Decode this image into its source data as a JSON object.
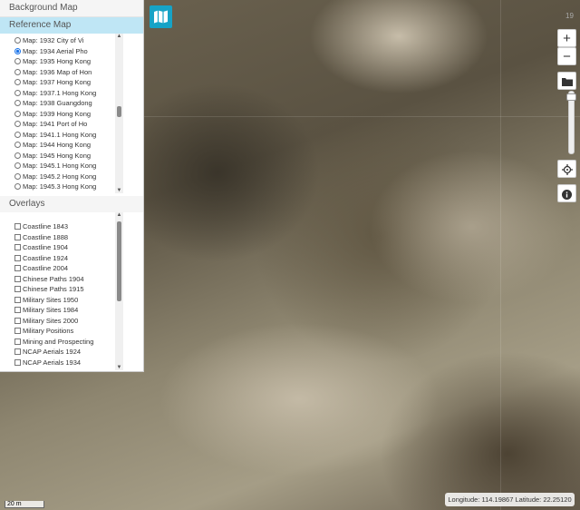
{
  "panel": {
    "background_header": "Background Map",
    "reference_header": "Reference Map",
    "overlays_header": "Overlays",
    "reference_items": [
      {
        "label": "Map: 1932 City of Vi",
        "selected": false
      },
      {
        "label": "Map: 1934 Aerial Pho",
        "selected": true
      },
      {
        "label": "Map: 1935 Hong Kong",
        "selected": false
      },
      {
        "label": "Map: 1936 Map of Hon",
        "selected": false
      },
      {
        "label": "Map: 1937 Hong Kong",
        "selected": false
      },
      {
        "label": "Map: 1937.1 Hong Kong",
        "selected": false
      },
      {
        "label": "Map: 1938 Guangdong",
        "selected": false
      },
      {
        "label": "Map: 1939 Hong Kong",
        "selected": false
      },
      {
        "label": "Map: 1941 Port of Ho",
        "selected": false
      },
      {
        "label": "Map: 1941.1 Hong Kong",
        "selected": false
      },
      {
        "label": "Map: 1944 Hong Kong",
        "selected": false
      },
      {
        "label": "Map: 1945 Hong Kong",
        "selected": false
      },
      {
        "label": "Map: 1945.1 Hong Kong",
        "selected": false
      },
      {
        "label": "Map: 1945.2 Hong Kong",
        "selected": false
      },
      {
        "label": "Map: 1945.3 Hong Kong",
        "selected": false
      }
    ],
    "overlay_items": [
      {
        "label": "Coastline 1843",
        "checked": false
      },
      {
        "label": "Coastline 1888",
        "checked": false
      },
      {
        "label": "Coastline 1904",
        "checked": false
      },
      {
        "label": "Coastline 1924",
        "checked": false
      },
      {
        "label": "Coastline 2004",
        "checked": false
      },
      {
        "label": "Chinese Paths 1904",
        "checked": false
      },
      {
        "label": "Chinese Paths 1915",
        "checked": false
      },
      {
        "label": "Military Sites 1950",
        "checked": false
      },
      {
        "label": "Military Sites 1984",
        "checked": false
      },
      {
        "label": "Military Sites 2000",
        "checked": false
      },
      {
        "label": "Military Positions",
        "checked": false
      },
      {
        "label": "Mining and Prospecting",
        "checked": false
      },
      {
        "label": "NCAP Aerials 1924",
        "checked": false
      },
      {
        "label": "NCAP Aerials 1934",
        "checked": false
      }
    ]
  },
  "controls": {
    "zoom_in": "+",
    "zoom_out": "−",
    "zoom_level": "19",
    "zoom_slider_fraction": 0.05
  },
  "scale": "20 m",
  "coords": "Longitude: 114.19867 Latitude: 22.25120",
  "colors": {
    "accent": "#16a3c6",
    "reference_header": "#bfe6f5",
    "selected_radio": "#1a73e8"
  },
  "icons": {
    "layers": "map-icon",
    "folder": "folder-icon",
    "locate": "crosshair-icon",
    "info": "info-icon"
  }
}
